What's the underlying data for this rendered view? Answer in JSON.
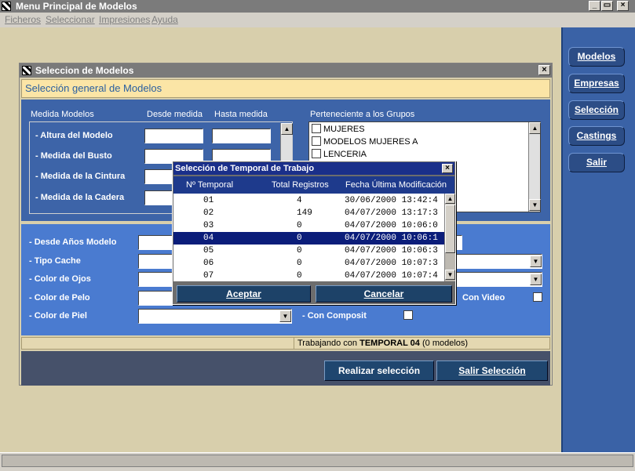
{
  "app": {
    "title": "Menu Principal de Modelos",
    "controls": {
      "minimize": "_",
      "maximize": "▭",
      "close": "×"
    }
  },
  "menu": [
    "Ficheros",
    "Seleccionar",
    "Impresiones",
    "Ayuda"
  ],
  "side_buttons": [
    "Modelos",
    "Empresas",
    "Selección",
    "Castings",
    "Salir"
  ],
  "child": {
    "title": "Seleccion de Modelos",
    "subtitle": "Selección general de Modelos",
    "measure_header": {
      "label": "Medida Modelos",
      "from": "Desde medida",
      "to": "Hasta medida"
    },
    "measures": [
      "- Altura del Modelo",
      "- Medida del Busto",
      "- Medida de la Cintura",
      "- Medida de la Cadera"
    ],
    "groups_label": "Perteneciente a los Grupos",
    "groups": [
      "MUJERES",
      "MODELOS MUJERES A",
      "LENCERIA"
    ],
    "fields": [
      "- Desde Años Modelo",
      "- Tipo Cache",
      "- Color de Ojos",
      "- Color de Pelo",
      "- Color de Piel"
    ],
    "checks": {
      "video": "Con Video",
      "composit": "- Con Composit"
    },
    "status": {
      "prefix": "Trabajando con",
      "temporal": "TEMPORAL 04",
      "suffix": "(0 modelos)"
    },
    "buttons": {
      "run": "Realizar selección",
      "exit": "Salir Selección"
    }
  },
  "dialog": {
    "title": "Selección de Temporal de Trabajo",
    "headers": [
      "Nº Temporal",
      "Total Registros",
      "Fecha Última Modificación"
    ],
    "rows": [
      {
        "n": "01",
        "total": "4",
        "date": "30/06/2000 13:42:4"
      },
      {
        "n": "02",
        "total": "149",
        "date": "04/07/2000 13:17:3"
      },
      {
        "n": "03",
        "total": "0",
        "date": "04/07/2000 10:06:0"
      },
      {
        "n": "04",
        "total": "0",
        "date": "04/07/2000 10:06:1"
      },
      {
        "n": "05",
        "total": "0",
        "date": "04/07/2000 10:06:3"
      },
      {
        "n": "06",
        "total": "0",
        "date": "04/07/2000 10:07:3"
      },
      {
        "n": "07",
        "total": "0",
        "date": "04/07/2000 10:07:4"
      }
    ],
    "selected_row": "04",
    "buttons": {
      "ok": "Aceptar",
      "cancel": "Cancelar"
    }
  },
  "colors": {
    "panel_blue": "#3a62a6",
    "dialog_title": "#1a2f8a",
    "selection": "#0b1d7a",
    "workspace": "#d8cfac"
  }
}
